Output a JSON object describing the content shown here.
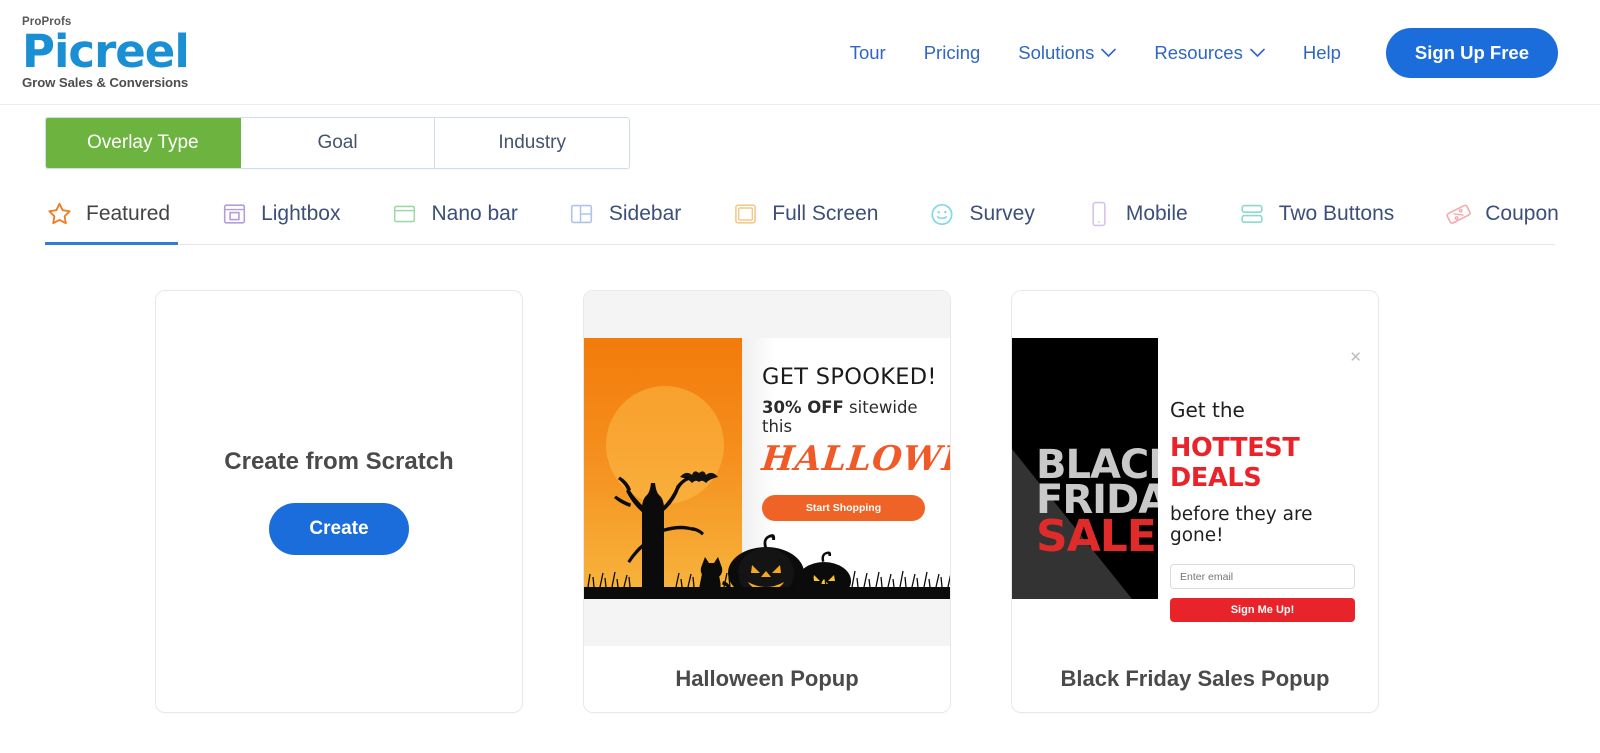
{
  "header": {
    "logo": {
      "top": "ProProfs",
      "main": "Picreel",
      "tagline": "Grow Sales & Conversions",
      "brand_color": "#1b8fd4"
    },
    "nav": [
      {
        "label": "Tour",
        "has_caret": false
      },
      {
        "label": "Pricing",
        "has_caret": false
      },
      {
        "label": "Solutions",
        "has_caret": true
      },
      {
        "label": "Resources",
        "has_caret": true
      },
      {
        "label": "Help",
        "has_caret": false
      }
    ],
    "signup_label": "Sign Up Free",
    "nav_color": "#2f66c4",
    "signup_color": "#1b6ddb"
  },
  "segments": {
    "active_index": 0,
    "active_color": "#6cb33f",
    "items": [
      {
        "label": "Overlay Type"
      },
      {
        "label": "Goal"
      },
      {
        "label": "Industry"
      }
    ]
  },
  "tabs": {
    "active_index": 0,
    "underline_color": "#2f7fd8",
    "items": [
      {
        "label": "Featured",
        "icon": "star-icon",
        "icon_color": "#f07c20"
      },
      {
        "label": "Lightbox",
        "icon": "lightbox-icon",
        "icon_color": "#b39ddb"
      },
      {
        "label": "Nano bar",
        "icon": "nano-bar-icon",
        "icon_color": "#9fd9a8"
      },
      {
        "label": "Sidebar",
        "icon": "sidebar-icon",
        "icon_color": "#aec4e8"
      },
      {
        "label": "Full Screen",
        "icon": "full-screen-icon",
        "icon_color": "#f2c98a"
      },
      {
        "label": "Survey",
        "icon": "survey-smiley-icon",
        "icon_color": "#7fd7e8"
      },
      {
        "label": "Mobile",
        "icon": "mobile-icon",
        "icon_color": "#d7c2ea"
      },
      {
        "label": "Two Buttons",
        "icon": "two-buttons-icon",
        "icon_color": "#8fd8cf"
      },
      {
        "label": "Coupon",
        "icon": "coupon-icon",
        "icon_color": "#f3a9ae"
      }
    ]
  },
  "cards": {
    "scratch": {
      "title": "Create from Scratch",
      "button_label": "Create",
      "button_color": "#1b6ddb"
    },
    "halloween": {
      "title": "Halloween Popup",
      "popup": {
        "headline": "GET SPOOKED!",
        "sub_bold": "30% OFF",
        "sub_rest": " sitewide this",
        "script_word": "HALLOWEEN",
        "cta_label": "Start Shopping",
        "cta_color": "#ef6327",
        "accent_color": "#ef5a28"
      }
    },
    "black_friday": {
      "title": "Black Friday Sales Popup",
      "popup": {
        "panel_line1": "BLACK",
        "panel_line2": "FRIDAY",
        "panel_line3": "SALE",
        "headline_top": "Get the",
        "headline_accent": "HOTTEST DEALS",
        "headline_bottom": "before they are gone!",
        "email_placeholder": "Enter email",
        "email_value": "",
        "cta_label": "Sign Me Up!",
        "cta_color": "#e8232a",
        "close_glyph": "✕"
      }
    }
  }
}
